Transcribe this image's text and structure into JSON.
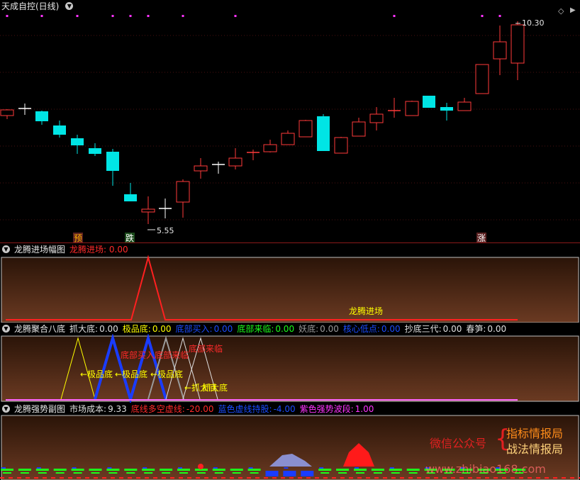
{
  "main": {
    "title": "天成自控(日线)",
    "price_high": "10.30",
    "price_low": "5.55",
    "signals": {
      "yu": "预",
      "die": "跌",
      "zhang": "涨"
    }
  },
  "pane1": {
    "title": "龙腾进场幅图",
    "indicator_label": "龙腾进场:",
    "indicator_value": "0.00",
    "annotation": "龙腾进场"
  },
  "pane2": {
    "title": "龙腾聚合八底",
    "indicators": [
      {
        "label": "抓大底:",
        "value": "0.00",
        "color": "#e0e0e0"
      },
      {
        "label": "极品底:",
        "value": "0.00",
        "color": "#ffff00"
      },
      {
        "label": "底部买入:",
        "value": "0.00",
        "color": "#1a4cff"
      },
      {
        "label": "底部来临:",
        "value": "0.00",
        "color": "#1aff1a"
      },
      {
        "label": "妖底:",
        "value": "0.00",
        "color": "#9a9a9a"
      },
      {
        "label": "核心低点:",
        "value": "0.00",
        "color": "#1a4cff"
      },
      {
        "label": "抄底三代:",
        "value": "0.00",
        "color": "#e0e0e0"
      },
      {
        "label": "春笋:",
        "value": "0.00",
        "color": "#e0e0e0"
      }
    ],
    "ann": {
      "jipin1": "←极品底",
      "jipin2": "←极品底",
      "jipin3": "←极品底",
      "dibu_mairu": "底部买入",
      "dibu_lailin": "底部来临",
      "zhuadadi1": "←抓大底",
      "zhuadadi2": "抓大底",
      "dibu_lailin2": "底部来临"
    }
  },
  "pane3": {
    "title": "龙腾强势副图",
    "indicators": [
      {
        "label": "市场成本:",
        "value": "9.33",
        "color": "#e0e0e0"
      },
      {
        "label": "底线多空虚线:",
        "value": "-20.00",
        "color": "#ff2a2a"
      },
      {
        "label": "蓝色虚线持股:",
        "value": "-4.00",
        "color": "#1a4cff"
      },
      {
        "label": "紫色强势波段:",
        "value": "1.00",
        "color": "#ff33ff"
      }
    ]
  },
  "watermark": {
    "wechat": "微信公众号",
    "line1": "指标情报局",
    "line2": "战法情报局",
    "url": "www.zhibiao168.com"
  },
  "colors": {
    "up": "#ff3a3a",
    "down": "#00e5e5",
    "border": "#8b1a1a"
  }
}
